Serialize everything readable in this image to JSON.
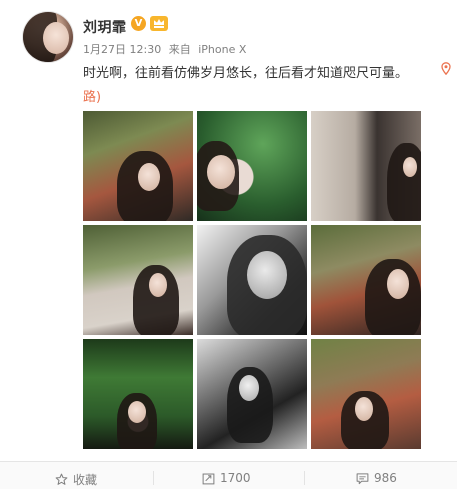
{
  "post": {
    "author": "刘玥霏",
    "verified_badge": "V",
    "time": "1月27日 12:30",
    "source_prefix": "来自",
    "source": "iPhone X",
    "text": "时光啊，往前看仿佛岁月悠长，往后看才知道咫尺可量。",
    "link_fragment": "路)"
  },
  "photos": [
    {
      "name": "photo-1",
      "icon": "photo"
    },
    {
      "name": "photo-2",
      "icon": "photo"
    },
    {
      "name": "photo-3",
      "icon": "photo"
    },
    {
      "name": "photo-4",
      "icon": "photo"
    },
    {
      "name": "photo-5",
      "icon": "photo"
    },
    {
      "name": "photo-6",
      "icon": "photo"
    },
    {
      "name": "photo-7",
      "icon": "photo"
    },
    {
      "name": "photo-8",
      "icon": "photo"
    },
    {
      "name": "photo-9",
      "icon": "photo"
    }
  ],
  "actions": {
    "favorite_label": "收藏",
    "repost_count": "1700",
    "comment_count": "986"
  },
  "colors": {
    "link": "#eb7350",
    "verified": "#f5a623",
    "meta": "#808080"
  }
}
